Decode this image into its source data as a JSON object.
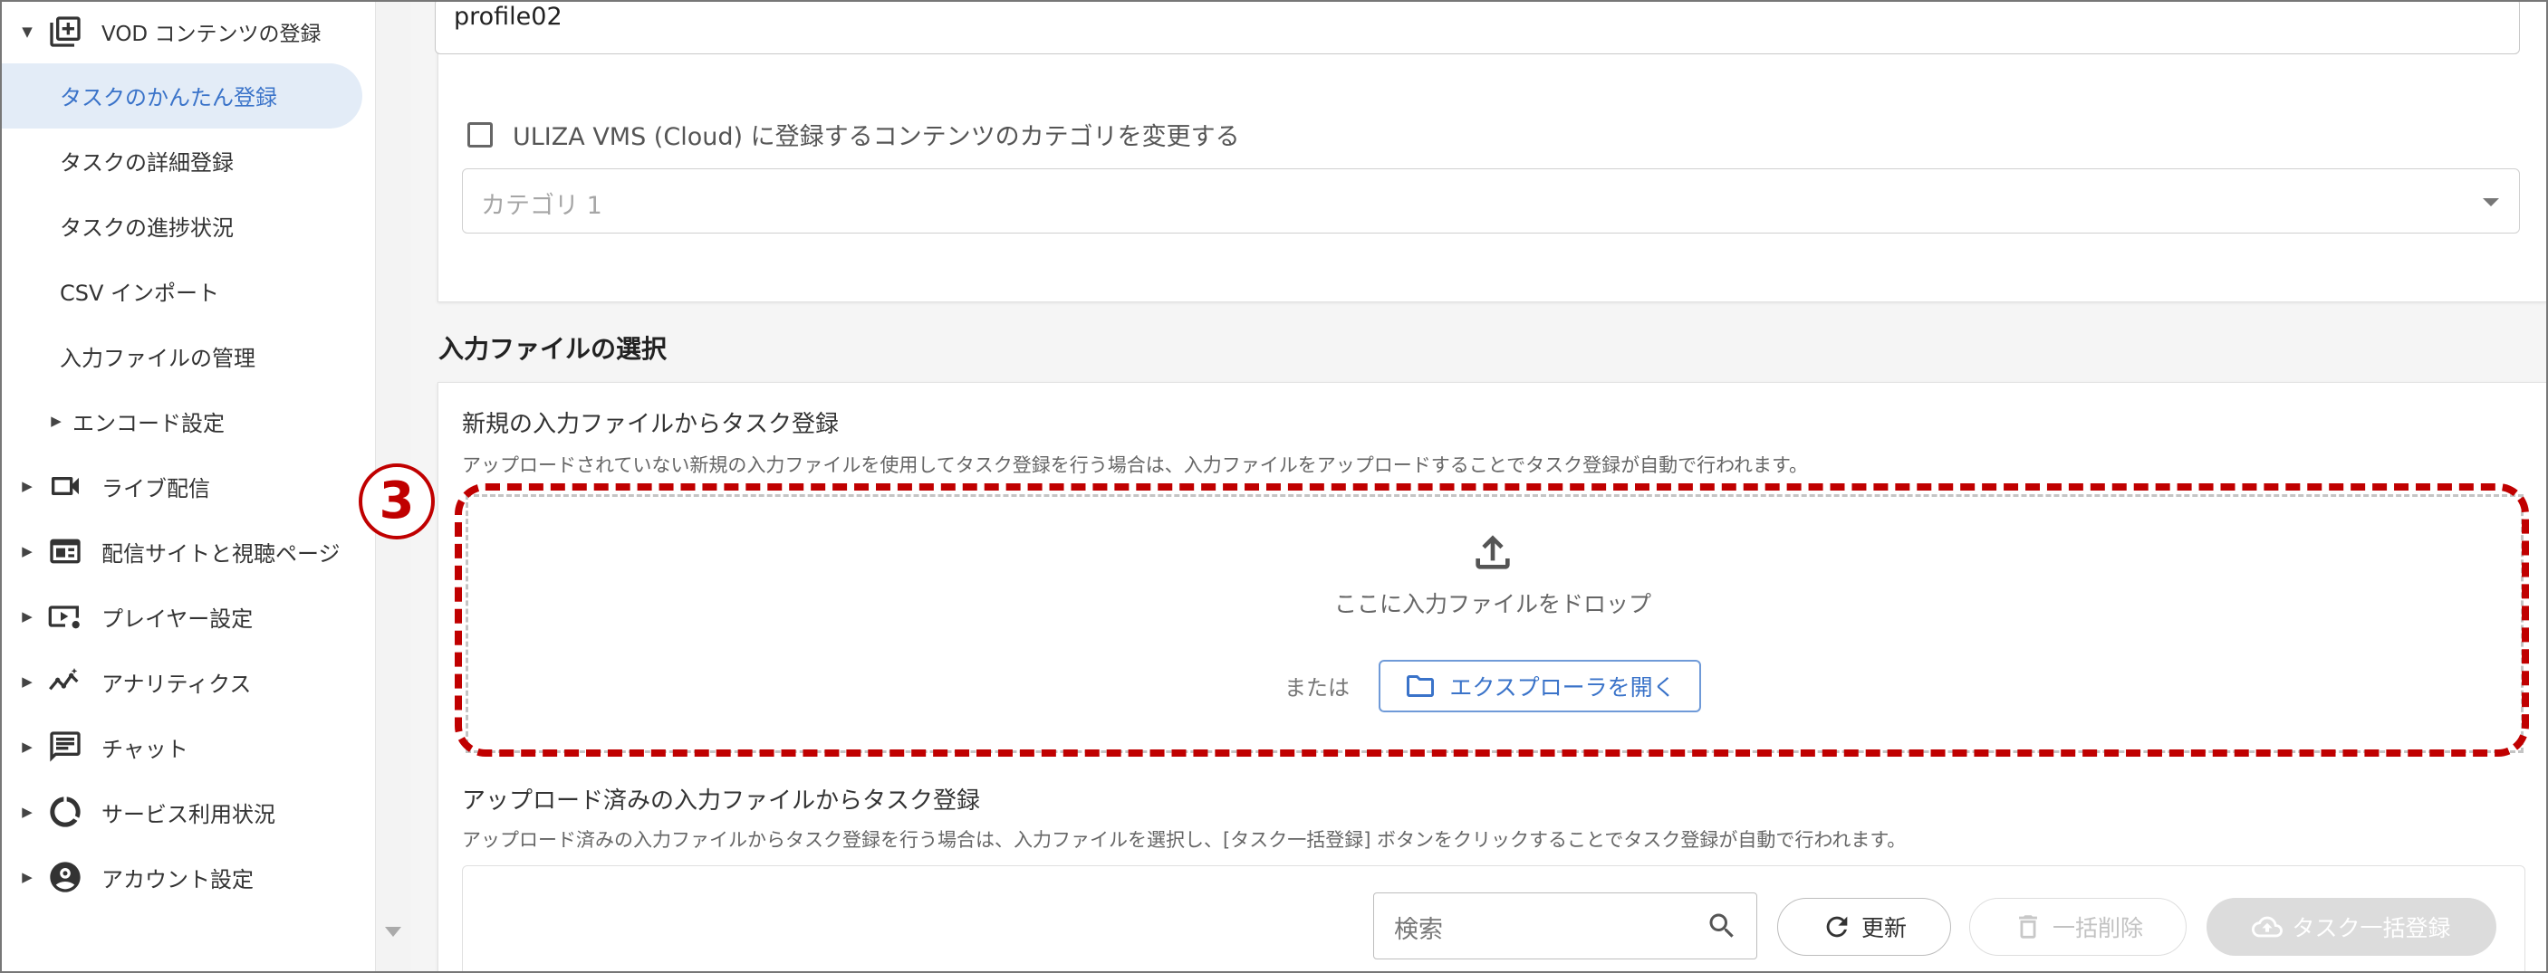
{
  "sidebar": {
    "vod_label": "VOD コンテンツの登録",
    "items": [
      {
        "label": "タスクのかんたん登録"
      },
      {
        "label": "タスクの詳細登録"
      },
      {
        "label": "タスクの進捗状況"
      },
      {
        "label": "CSV インポート"
      },
      {
        "label": "入力ファイルの管理"
      },
      {
        "label": "エンコード設定"
      },
      {
        "label": "ライブ配信"
      },
      {
        "label": "配信サイトと視聴ページ"
      },
      {
        "label": "プレイヤー設定"
      },
      {
        "label": "アナリティクス"
      },
      {
        "label": "チャット"
      },
      {
        "label": "サービス利用状況"
      },
      {
        "label": "アカウント設定"
      }
    ],
    "icons": [
      "add-box-icon",
      "video-camera-icon",
      "web-page-icon",
      "player-settings-icon",
      "analytics-icon",
      "chat-icon",
      "usage-icon",
      "account-icon"
    ]
  },
  "form": {
    "profile_value": "profile02",
    "category_checkbox_label": "ULIZA VMS (Cloud) に登録するコンテンツのカテゴリを変更する",
    "category_placeholder": "カテゴリ 1"
  },
  "input_file": {
    "section_title": "入力ファイルの選択",
    "new_heading": "新規の入力ファイルからタスク登録",
    "new_desc": "アップロードされていない新規の入力ファイルを使用してタスク登録を行う場合は、入力ファイルをアップロードすることでタスク登録が自動で行われます。",
    "drop_text": "ここに入力ファイルをドロップ",
    "or_text": "または",
    "explorer_button": "エクスプローラを開く",
    "step_marker": "3",
    "uploaded_heading": "アップロード済みの入力ファイルからタスク登録",
    "uploaded_desc": "アップロード済みの入力ファイルからタスク登録を行う場合は、入力ファイルを選択し、[タスク一括登録] ボタンをクリックすることでタスク登録が自動で行われます。",
    "search_placeholder": "検索",
    "refresh_button": "更新",
    "bulk_delete_button": "一括削除",
    "bulk_register_button": "タスク一括登録"
  },
  "colors": {
    "accent": "#3a73c9",
    "active_bg": "#e3ecf7",
    "highlight": "#c00000"
  }
}
